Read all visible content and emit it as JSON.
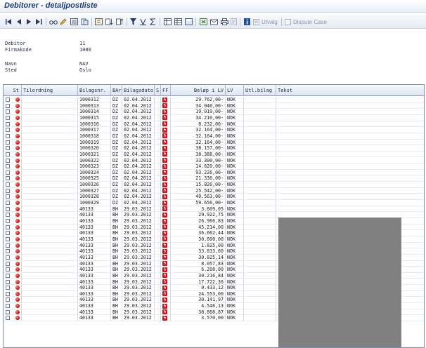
{
  "window": {
    "title": "Debitorer - detaljpostliste"
  },
  "toolbar": {
    "utvalg_label": "Utvalg",
    "dispute_label": "Dispute Case",
    "icons": [
      "first-page-icon",
      "previous-page-icon",
      "next-page-icon",
      "last-page-icon",
      "glasses-icon",
      "pencil-icon",
      "list-icon",
      "document-icon",
      "details-icon",
      "sort-ascending-icon",
      "sort-descending-icon",
      "filter-icon",
      "total-icon",
      "subtotal-icon",
      "layout-icon",
      "select-layout-icon",
      "save-layout-icon",
      "export-icon",
      "mail-icon",
      "print-icon",
      "info-icon"
    ]
  },
  "header": {
    "fields": [
      {
        "label": "Debitor",
        "value": "11"
      },
      {
        "label": "Firmakode",
        "value": "1000"
      },
      {
        "label": "Navn",
        "value": "NAV"
      },
      {
        "label": "Sted",
        "value": "Oslo"
      }
    ]
  },
  "table": {
    "columns": [
      "St",
      "Tilordning",
      "Bilagsnr.",
      "BAr",
      "Bilagsdato",
      "S",
      "FF",
      "Beløp i LV",
      "LV",
      "Utl.bilag",
      "Tekst"
    ],
    "rows": [
      [
        "1000312",
        "DZ",
        "02.04.2012",
        "29.762,00-",
        "NOK"
      ],
      [
        "1000313",
        "DZ",
        "02.04.2012",
        "34.040,00-",
        "NOK"
      ],
      [
        "1000314",
        "DZ",
        "02.04.2012",
        "19.019,00-",
        "NOK"
      ],
      [
        "1000315",
        "DZ",
        "02.04.2012",
        "34.210,00-",
        "NOK"
      ],
      [
        "1000316",
        "DZ",
        "02.04.2012",
        "8.232,00-",
        "NOK"
      ],
      [
        "1000317",
        "DZ",
        "02.04.2012",
        "32.164,00-",
        "NOK"
      ],
      [
        "1000318",
        "DZ",
        "02.04.2012",
        "32.164,00-",
        "NOK"
      ],
      [
        "1000319",
        "DZ",
        "02.04.2012",
        "32.164,00-",
        "NOK"
      ],
      [
        "1000320",
        "DZ",
        "02.04.2012",
        "38.157,00-",
        "NOK"
      ],
      [
        "1000321",
        "DZ",
        "02.04.2012",
        "38.388,00-",
        "NOK"
      ],
      [
        "1000322",
        "DZ",
        "02.04.2012",
        "33.300,00-",
        "NOK"
      ],
      [
        "1000323",
        "DZ",
        "02.04.2012",
        "14.620,00-",
        "NOK"
      ],
      [
        "1000324",
        "DZ",
        "02.04.2012",
        "93.226,00-",
        "NOK"
      ],
      [
        "1000325",
        "DZ",
        "02.04.2012",
        "21.330,00-",
        "NOK"
      ],
      [
        "1000326",
        "DZ",
        "02.04.2012",
        "15.820,00-",
        "NOK"
      ],
      [
        "1000327",
        "DZ",
        "02.04.2012",
        "25.542,00-",
        "NOK"
      ],
      [
        "1000328",
        "DZ",
        "02.04.2012",
        "40.563,00-",
        "NOK"
      ],
      [
        "1000329",
        "DZ",
        "02.04.2012",
        "59.656,00-",
        "NOK"
      ],
      [
        "40133",
        "BH",
        "29.03.2012",
        "3.609,05",
        "NOK"
      ],
      [
        "40133",
        "BH",
        "29.03.2012",
        "29.922,75",
        "NOK"
      ],
      [
        "40133",
        "BH",
        "29.03.2012",
        "26.966,83",
        "NOK"
      ],
      [
        "40133",
        "BH",
        "29.03.2012",
        "45.214,00",
        "NOK"
      ],
      [
        "40133",
        "BH",
        "29.03.2012",
        "36.662,44",
        "NOK"
      ],
      [
        "40133",
        "BH",
        "29.03.2012",
        "30.600,00",
        "NOK"
      ],
      [
        "40133",
        "BH",
        "29.03.2012",
        "1.825,00",
        "NOK"
      ],
      [
        "40133",
        "BH",
        "29.03.2012",
        "33.833,60",
        "NOK"
      ],
      [
        "40133",
        "BH",
        "29.03.2012",
        "30.825,14",
        "NOK"
      ],
      [
        "40133",
        "BH",
        "29.03.2012",
        "8.057,83",
        "NOK"
      ],
      [
        "40133",
        "BH",
        "29.03.2012",
        "6.208,00",
        "NOK"
      ],
      [
        "40133",
        "BH",
        "29.03.2012",
        "30.216,84",
        "NOK"
      ],
      [
        "40133",
        "BH",
        "29.03.2012",
        "17.722,36",
        "NOK"
      ],
      [
        "40133",
        "BH",
        "29.03.2012",
        "9.433,12",
        "NOK"
      ],
      [
        "40133",
        "BH",
        "29.03.2012",
        "24.553,00",
        "NOK"
      ],
      [
        "40133",
        "BH",
        "29.03.2012",
        "30.141,97",
        "NOK"
      ],
      [
        "40133",
        "BH",
        "29.03.2012",
        "4.546,13",
        "NOK"
      ],
      [
        "40133",
        "BH",
        "29.03.2012",
        "38.868,87",
        "NOK"
      ],
      [
        "40133",
        "BH",
        "29.03.2012",
        "3.570,00",
        "NOK"
      ]
    ]
  }
}
